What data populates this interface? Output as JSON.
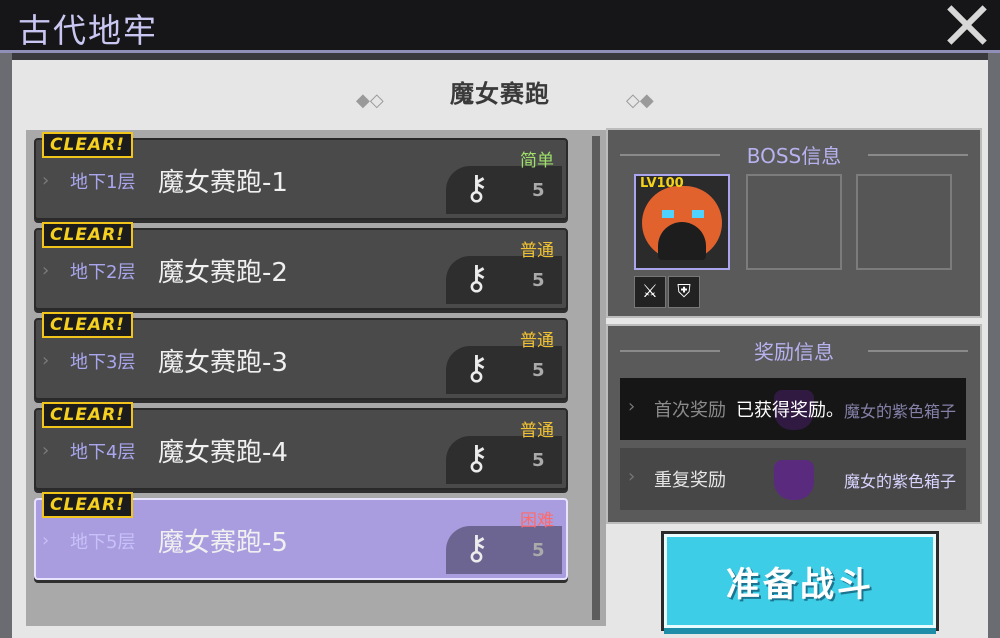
{
  "window": {
    "title": "古代地牢"
  },
  "panel": {
    "header": "魔女赛跑"
  },
  "stages": [
    {
      "clear": "CLEAR!",
      "floor": "地下1层",
      "name": "魔女赛跑-1",
      "difficulty": "简单",
      "difficulty_color": "#9ee06a",
      "key_count": "5"
    },
    {
      "clear": "CLEAR!",
      "floor": "地下2层",
      "name": "魔女赛跑-2",
      "difficulty": "普通",
      "difficulty_color": "#f1c232",
      "key_count": "5"
    },
    {
      "clear": "CLEAR!",
      "floor": "地下3层",
      "name": "魔女赛跑-3",
      "difficulty": "普通",
      "difficulty_color": "#f1c232",
      "key_count": "5"
    },
    {
      "clear": "CLEAR!",
      "floor": "地下4层",
      "name": "魔女赛跑-4",
      "difficulty": "普通",
      "difficulty_color": "#f1c232",
      "key_count": "5"
    },
    {
      "clear": "CLEAR!",
      "floor": "地下5层",
      "name": "魔女赛跑-5",
      "difficulty": "困难",
      "difficulty_color": "#ff6a6a",
      "key_count": "5"
    }
  ],
  "boss": {
    "section_title": "BOSS信息",
    "level": "LV100"
  },
  "rewards": {
    "section_title": "奖励信息",
    "first_label": "首次奖励",
    "first_status": "已获得奖励。",
    "first_item": "魔女的紫色箱子",
    "repeat_label": "重复奖励",
    "repeat_item": "魔女的紫色箱子"
  },
  "fight_button": "准备战斗"
}
